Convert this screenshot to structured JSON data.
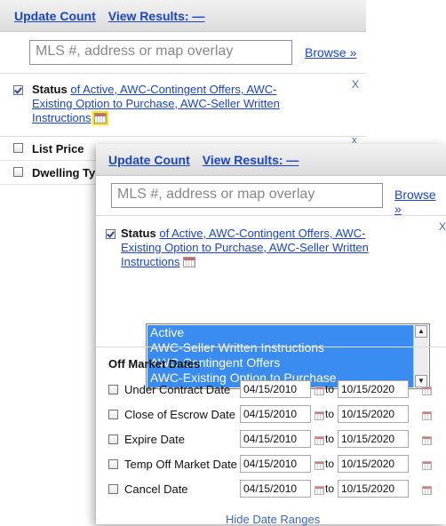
{
  "back_panel": {
    "toolbar": {
      "update_count": "Update Count",
      "view_results": "View Results: —"
    },
    "search": {
      "placeholder": "MLS #, address or map overlay",
      "browse": "Browse »"
    },
    "status": {
      "label": "Status",
      "value_line1": "of Active, AWC-Contingent Offers, AWC-",
      "value_line2": "Existing Option to Purchase, AWC-Seller Written",
      "value_line3": "Instructions",
      "checked": true,
      "close": "X"
    },
    "rows": [
      {
        "label": "List Price"
      },
      {
        "label": "Dwelling Ty"
      }
    ],
    "row_close": "x"
  },
  "front_panel": {
    "toolbar": {
      "update_count": "Update Count",
      "view_results": "View Results: —"
    },
    "search": {
      "placeholder": "MLS #, address or map overlay",
      "browse": "Browse »"
    },
    "status": {
      "label": "Status",
      "value_line1": "of Active, AWC-Contingent Offers, AWC-",
      "value_line2": "Existing Option to Purchase, AWC-Seller Written",
      "value_line3": "Instructions",
      "checked": true,
      "close": "X"
    },
    "status_options": [
      "Active",
      "AWC-Seller Written Instructions",
      "AWC-Contingent Offers",
      "AWC-Existing Option to Purchase"
    ],
    "off_market": {
      "title": "Off Market Dates",
      "to_label": "to",
      "rows": [
        {
          "label": "Under Contract Date",
          "from": "04/15/2010",
          "to": "10/15/2020"
        },
        {
          "label": "Close of Escrow Date",
          "from": "04/15/2010",
          "to": "10/15/2020"
        },
        {
          "label": "Expire Date",
          "from": "04/15/2010",
          "to": "10/15/2020"
        },
        {
          "label": "Temp Off Market Date",
          "from": "04/15/2010",
          "to": "10/15/2020"
        },
        {
          "label": "Cancel Date",
          "from": "04/15/2010",
          "to": "10/15/2020"
        }
      ]
    },
    "hide_link": "Hide Date Ranges"
  },
  "colors": {
    "link": "#1a45c6",
    "selection": "#3a8cf0",
    "highlight": "#ffe600"
  }
}
